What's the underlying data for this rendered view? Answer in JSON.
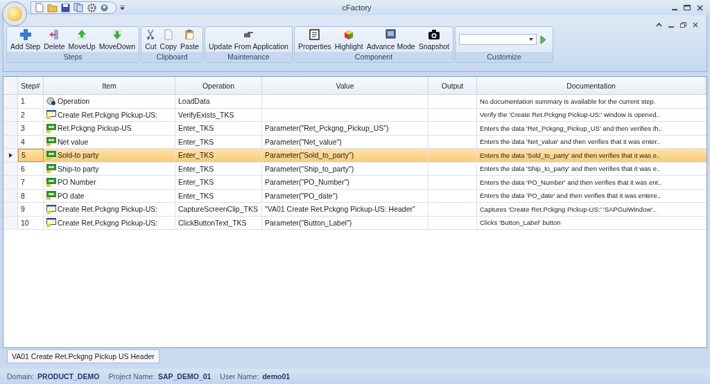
{
  "window": {
    "title": "cFactory"
  },
  "ribbon": {
    "groups": [
      {
        "label": "Steps",
        "buttons": [
          "Add Step",
          "Delete",
          "MoveUp",
          "MoveDown"
        ]
      },
      {
        "label": "Clipboard",
        "buttons": [
          "Cut",
          "Copy",
          "Paste"
        ]
      },
      {
        "label": "Maintenance",
        "buttons": [
          "Update From Application"
        ]
      },
      {
        "label": "Component",
        "buttons": [
          "Properties",
          "Highlight",
          "Advance Mode",
          "Snapshot"
        ]
      },
      {
        "label": "Customize"
      }
    ]
  },
  "table": {
    "columns": [
      "Step#",
      "Item",
      "Operation",
      "Value",
      "Output",
      "Documentation"
    ],
    "rows": [
      {
        "step": "1",
        "kind": "operation",
        "item": "Operation",
        "operation": "LoadData",
        "documentation": "No documentation summary is available for the current step.",
        "selected": false
      },
      {
        "step": "2",
        "kind": "window",
        "item": "Create Ret.Pckgng Pickup-US:",
        "operation": "VerifyExists_TKS",
        "documentation": "Verify the  'Create Ret.Pckgng Pickup-US:'  window is opened..",
        "selected": false
      },
      {
        "step": "3",
        "kind": "field",
        "item": "Ret.Pckgng Pickup-US",
        "operation": "Enter_TKS",
        "value": "Parameter(\"Ret_Pckgng_Pickup_US\")",
        "documentation": "Enters the data  'Ret_Pckgng_Pickup_US'  and then verifies th..",
        "selected": false
      },
      {
        "step": "4",
        "kind": "field",
        "item": "Net value",
        "operation": "Enter_TKS",
        "value": "Parameter(\"Net_value\")",
        "documentation": "Enters the data  'Net_value'  and then verifies that it was enter..",
        "selected": false
      },
      {
        "step": "5",
        "kind": "field",
        "item": "Sold-to party",
        "operation": "Enter_TKS",
        "value": "Parameter(\"Sold_to_party\")",
        "documentation": "Enters the data  'Sold_to_party'  and then verifies that it was e..",
        "selected": true
      },
      {
        "step": "6",
        "kind": "field",
        "item": "Ship-to party",
        "operation": "Enter_TKS",
        "value": "Parameter(\"Ship_to_party\")",
        "documentation": "Enters the data  'Ship_to_party'  and then verifies that it was e..",
        "selected": false
      },
      {
        "step": "7",
        "kind": "field",
        "item": "PO Number",
        "operation": "Enter_TKS",
        "value": "Parameter(\"PO_Number\")",
        "documentation": "Enters the data  'PO_Number'  and then verifies that it was ent..",
        "selected": false
      },
      {
        "step": "8",
        "kind": "field",
        "item": "PO date",
        "operation": "Enter_TKS",
        "value": "Parameter(\"PO_date\")",
        "documentation": "Enters the data  'PO_date'  and then verifies that it was entere..",
        "selected": false
      },
      {
        "step": "9",
        "kind": "window",
        "item": "Create Ret.Pckgng Pickup-US:",
        "operation": "CaptureScreenClip_TKS",
        "value": "\"VA01 Create Ret.Pckgng Pickup-US: Header\"",
        "documentation": "Captures  'Create Ret.Pckgng Pickup-US:'    'SAPGuiWindow'..",
        "selected": false
      },
      {
        "step": "10",
        "kind": "window",
        "item": "Create Ret.Pckgng Pickup-US:",
        "operation": "ClickButtonText_TKS",
        "value": "Parameter(\"Button_Label\")",
        "documentation": "Clicks  'Button_Label'  button",
        "selected": false
      }
    ]
  },
  "document_tabs": [
    {
      "label": "VA01 Create Ret.Pckgng Pickup US Header",
      "selected": true
    }
  ],
  "status_bar": [
    {
      "label": "Domain:",
      "value": "PRODUCT_DEMO"
    },
    {
      "label": "Project Name:",
      "value": "SAP_DEMO_01"
    },
    {
      "label": "User Name:",
      "value": "demo01"
    }
  ]
}
